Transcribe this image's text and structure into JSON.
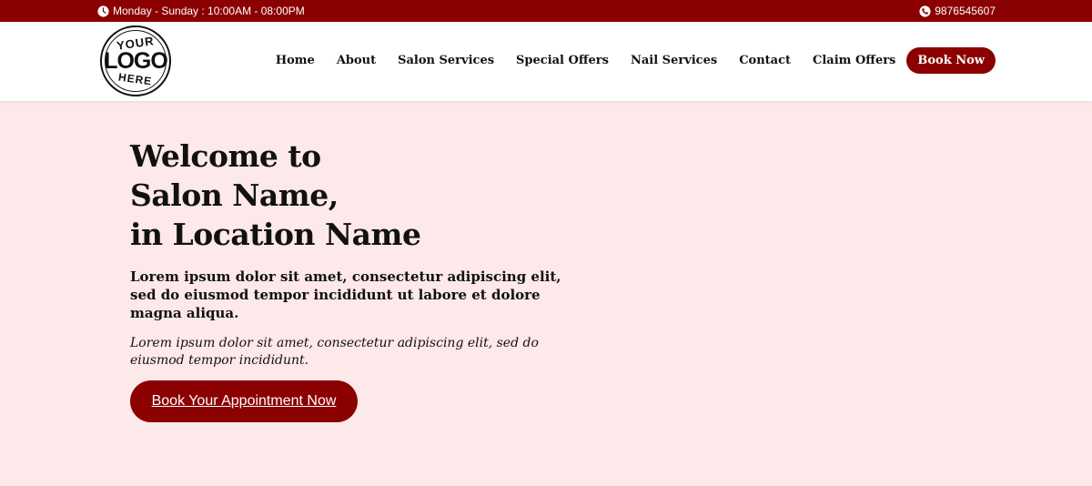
{
  "topbar": {
    "hours": "Monday - Sunday : 10:00AM - 08:00PM",
    "phone": "9876545607",
    "hours_icon": "clock-icon",
    "phone_icon": "phone-icon",
    "background": "#8b0000"
  },
  "logo": {
    "line1": "YOUR",
    "line2": "LOGO",
    "line3": "HERE"
  },
  "nav": {
    "items": [
      {
        "label": "Home"
      },
      {
        "label": "About"
      },
      {
        "label": "Salon Services"
      },
      {
        "label": "Special Offers"
      },
      {
        "label": "Nail Services"
      },
      {
        "label": "Contact"
      },
      {
        "label": "Claim Offers"
      }
    ],
    "book_now": "Book Now"
  },
  "hero": {
    "title_line1": "Welcome to",
    "title_line2": "Salon Name,",
    "title_line3": "in Location Name",
    "lead": "Lorem ipsum dolor sit amet, consectetur adipiscing elit, sed do eiusmod tempor incididunt ut labore et dolore magna aliqua.",
    "sub": "Lorem ipsum dolor sit amet, consectetur adipiscing elit, sed do eiusmod tempor incididunt.",
    "cta": "Book Your Appointment Now"
  },
  "colors": {
    "accent": "#8b0000",
    "hero_background": "#fde8ea"
  }
}
